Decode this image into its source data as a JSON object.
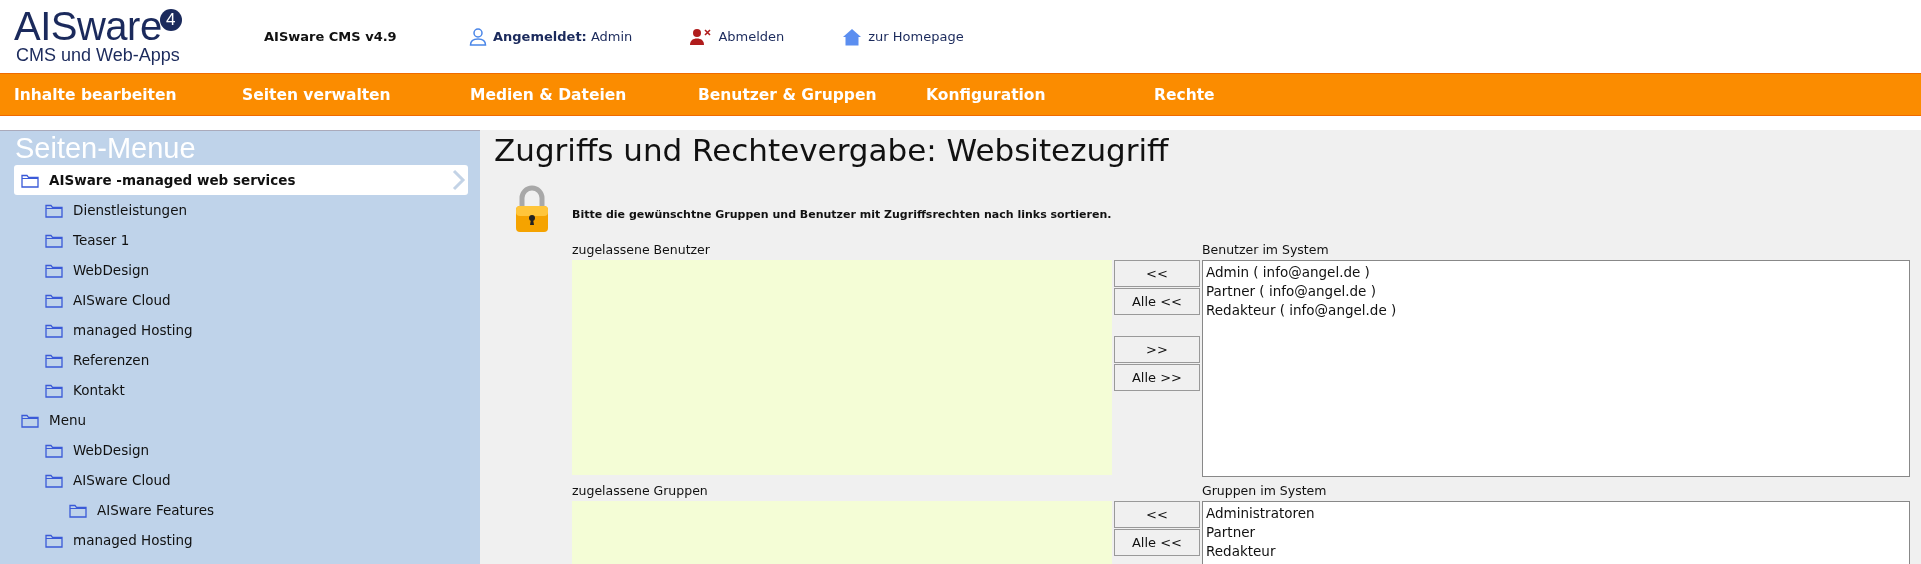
{
  "header": {
    "logo": {
      "name": "AISware",
      "badge": "4",
      "subtitle": "CMS und Web-Apps"
    },
    "version": "AISware CMS v4.9",
    "user": "**Angemeldet:** Admin",
    "logout": "Abmelden",
    "homepage": "zur Homepage"
  },
  "nav": [
    "Inhalte bearbeiten",
    "Seiten verwalten",
    "Medien & Dateien",
    "Benutzer & Gruppen",
    "Konfiguration",
    "Rechte"
  ],
  "sidebar": {
    "title": "Seiten-Menue",
    "tree": [
      {
        "label": "AISware -managed web services",
        "selected": true,
        "children": [
          {
            "label": "Dienstleistungen",
            "selected": false
          },
          {
            "label": "Teaser 1",
            "selected": false
          },
          {
            "label": "WebDesign",
            "selected": false
          },
          {
            "label": "AISware Cloud",
            "selected": false
          },
          {
            "label": "managed Hosting",
            "selected": false
          },
          {
            "label": "Referenzen",
            "selected": false
          },
          {
            "label": "Kontakt",
            "selected": false
          }
        ]
      },
      {
        "label": "Menu",
        "selected": false,
        "children": [
          {
            "label": "WebDesign",
            "selected": false
          },
          {
            "label": "AISware Cloud",
            "selected": false,
            "children": [
              {
                "label": "AISware Features",
                "selected": false
              }
            ]
          },
          {
            "label": "managed Hosting",
            "selected": false
          }
        ]
      }
    ]
  },
  "main": {
    "title": "Zugriffs und Rechtevergabe: Websitezugriff",
    "instruction": "Bitte die gewünschtne Gruppen und Benutzer mit Zugriffsrechten nach links sortieren.",
    "sections": [
      {
        "allowed_label": "zugelassene Benutzer",
        "system_label": "Benutzer im System",
        "system_items": [
          "Admin ( info@angel.de )",
          "Partner ( info@angel.de )",
          "Redakteur ( info@angel.de )"
        ],
        "buttons": [
          "<<",
          "Alle <<",
          ">>",
          "Alle >>"
        ]
      },
      {
        "allowed_label": "zugelassene Gruppen",
        "system_label": "Gruppen im System",
        "system_items": [
          "Administratoren",
          "Partner",
          "Redakteur"
        ],
        "buttons": [
          "<<",
          "Alle <<"
        ]
      }
    ]
  }
}
